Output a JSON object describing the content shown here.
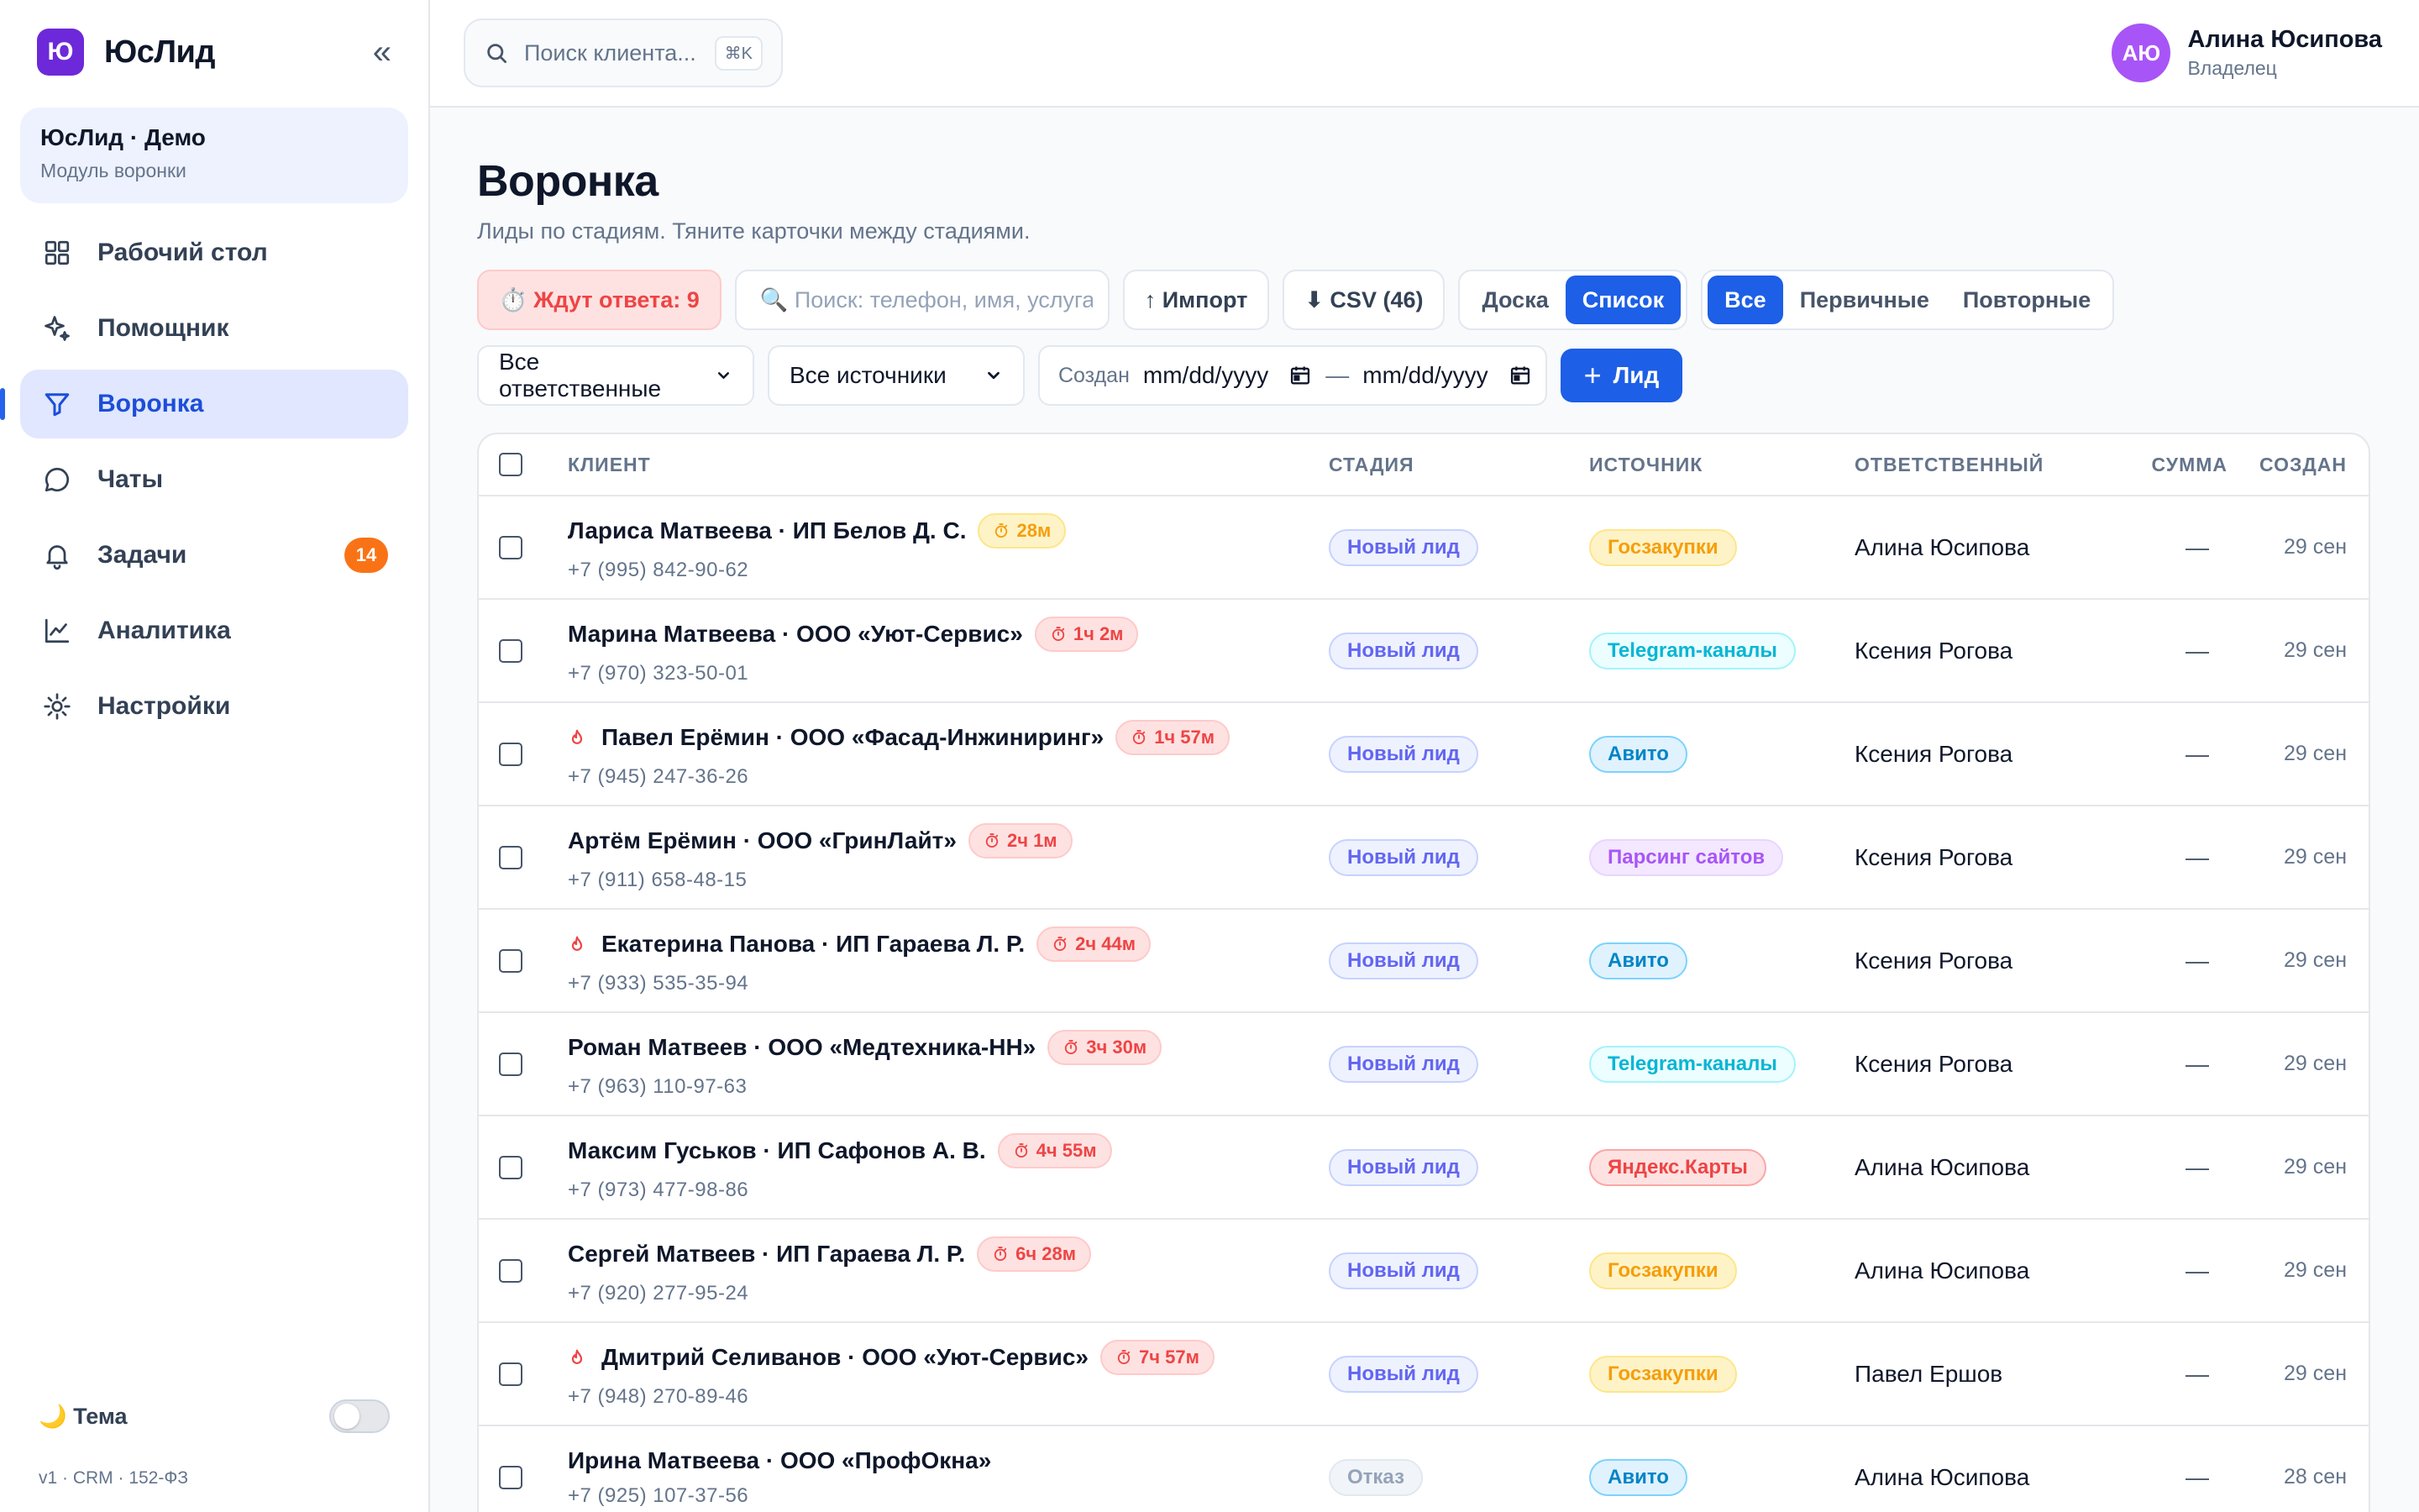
{
  "brand": {
    "logo_letter": "Ю",
    "name": "ЮсЛид",
    "collapse": "«"
  },
  "workspace": {
    "name": "ЮсЛид · Демо",
    "subtitle": "Модуль воронки"
  },
  "nav": [
    {
      "key": "dashboard",
      "label": "Рабочий стол",
      "icon": "grid-icon",
      "active": false
    },
    {
      "key": "assistant",
      "label": "Помощник",
      "icon": "sparkle-icon",
      "active": false
    },
    {
      "key": "funnel",
      "label": "Воронка",
      "icon": "funnel-icon",
      "active": true
    },
    {
      "key": "chats",
      "label": "Чаты",
      "icon": "chat-icon",
      "active": false
    },
    {
      "key": "tasks",
      "label": "Задачи",
      "icon": "bell-icon",
      "active": false,
      "badge": "14"
    },
    {
      "key": "analytics",
      "label": "Аналитика",
      "icon": "chart-line-icon",
      "active": false
    },
    {
      "key": "settings",
      "label": "Настройки",
      "icon": "sun-gear-icon",
      "active": false
    }
  ],
  "theme": {
    "label": "🌙 Тема",
    "dark": false
  },
  "version": "v1 · CRM · 152-ФЗ",
  "topbar": {
    "search_placeholder": "Поиск клиента...",
    "search_shortcut": "⌘K",
    "user": {
      "initials": "АЮ",
      "name": "Алина Юсипова",
      "role": "Владелец"
    }
  },
  "page": {
    "title": "Воронка",
    "subtitle": "Лиды по стадиям. Тяните карточки между стадиями."
  },
  "toolbar": {
    "awaiting": "⏱️ Ждут ответа: 9",
    "search_placeholder": "🔍 Поиск: телефон, имя, услуга",
    "import": "↑ Импорт",
    "csv": "⬇ CSV (46)",
    "view": {
      "board": "Доска",
      "list": "Список",
      "active": "list"
    },
    "type": {
      "all": "Все",
      "primary": "Первичные",
      "repeat": "Повторные",
      "active": "all"
    }
  },
  "filters": {
    "owner": "Все ответственные",
    "source": "Все источники",
    "created_label": "Создан",
    "date_from": "mm/dd/yyyy",
    "date_sep": "—",
    "date_to": "mm/dd/yyyy",
    "add_lead": "Лид",
    "add_plus": "+"
  },
  "table": {
    "columns": [
      "Клиент",
      "Стадия",
      "Источник",
      "Ответственный",
      "Сумма",
      "Создан"
    ],
    "rows": [
      {
        "hot": false,
        "client": "Лариса Матвеева · ИП Белов Д. С.",
        "timer": "28м",
        "timer_level": "amber",
        "phone": "+7 (995) 842-90-62",
        "stage": "Новый лид",
        "stage_kind": "new",
        "source": "Госзакупки",
        "source_kind": "gov",
        "owner": "Алина Юсипова",
        "sum": "—",
        "created": "29 сен"
      },
      {
        "hot": false,
        "client": "Марина Матвеева · ООО «Уют-Сервис»",
        "timer": "1ч 2м",
        "timer_level": "red",
        "phone": "+7 (970) 323-50-01",
        "stage": "Новый лид",
        "stage_kind": "new",
        "source": "Telegram-каналы",
        "source_kind": "tg",
        "owner": "Ксения Рогова",
        "sum": "—",
        "created": "29 сен"
      },
      {
        "hot": true,
        "client": "Павел Ерёмин · ООО «Фасад-Инжиниринг»",
        "timer": "1ч 57м",
        "timer_level": "red",
        "phone": "+7 (945) 247-36-26",
        "stage": "Новый лид",
        "stage_kind": "new",
        "source": "Авито",
        "source_kind": "avito",
        "owner": "Ксения Рогова",
        "sum": "—",
        "created": "29 сен"
      },
      {
        "hot": false,
        "client": "Артём Ерёмин · ООО «ГринЛайт»",
        "timer": "2ч 1м",
        "timer_level": "red",
        "phone": "+7 (911) 658-48-15",
        "stage": "Новый лид",
        "stage_kind": "new",
        "source": "Парсинг сайтов",
        "source_kind": "parse",
        "owner": "Ксения Рогова",
        "sum": "—",
        "created": "29 сен"
      },
      {
        "hot": true,
        "client": "Екатерина Панова · ИП Гараева Л. Р.",
        "timer": "2ч 44м",
        "timer_level": "red",
        "phone": "+7 (933) 535-35-94",
        "stage": "Новый лид",
        "stage_kind": "new",
        "source": "Авито",
        "source_kind": "avito",
        "owner": "Ксения Рогова",
        "sum": "—",
        "created": "29 сен"
      },
      {
        "hot": false,
        "client": "Роман Матвеев · ООО «Медтехника-НН»",
        "timer": "3ч 30м",
        "timer_level": "red",
        "phone": "+7 (963) 110-97-63",
        "stage": "Новый лид",
        "stage_kind": "new",
        "source": "Telegram-каналы",
        "source_kind": "tg",
        "owner": "Ксения Рогова",
        "sum": "—",
        "created": "29 сен"
      },
      {
        "hot": false,
        "client": "Максим Гуськов · ИП Сафонов А. В.",
        "timer": "4ч 55м",
        "timer_level": "red",
        "phone": "+7 (973) 477-98-86",
        "stage": "Новый лид",
        "stage_kind": "new",
        "source": "Яндекс.Карты",
        "source_kind": "yandex",
        "owner": "Алина Юсипова",
        "sum": "—",
        "created": "29 сен"
      },
      {
        "hot": false,
        "client": "Сергей Матвеев · ИП Гараева Л. Р.",
        "timer": "6ч 28м",
        "timer_level": "red",
        "phone": "+7 (920) 277-95-24",
        "stage": "Новый лид",
        "stage_kind": "new",
        "source": "Госзакупки",
        "source_kind": "gov",
        "owner": "Алина Юсипова",
        "sum": "—",
        "created": "29 сен"
      },
      {
        "hot": true,
        "client": "Дмитрий Селиванов · ООО «Уют-Сервис»",
        "timer": "7ч 57м",
        "timer_level": "red",
        "phone": "+7 (948) 270-89-46",
        "stage": "Новый лид",
        "stage_kind": "new",
        "source": "Госзакупки",
        "source_kind": "gov",
        "owner": "Павел Ершов",
        "sum": "—",
        "created": "29 сен"
      },
      {
        "hot": false,
        "client": "Ирина Матвеева · ООО «ПрофОкна»",
        "timer": "",
        "timer_level": "",
        "phone": "+7 (925) 107-37-56",
        "stage": "Отказ",
        "stage_kind": "lost",
        "source": "Авито",
        "source_kind": "avito",
        "owner": "Алина Юсипова",
        "sum": "—",
        "created": "28 сен"
      }
    ]
  },
  "colors": {
    "accent": "#1d5fe6",
    "brand": "#6d28d9",
    "stage_new": {
      "bg": "#eef2ff",
      "border": "#c7d2fe",
      "text": "#6366f1"
    },
    "stage_lost": {
      "bg": "#f1f5f9",
      "border": "#e2e8f0",
      "text": "#94a3b8"
    },
    "source_gov": {
      "bg": "#fef3c7",
      "border": "#fde68a",
      "text": "#f59e0b"
    },
    "source_tg": {
      "bg": "#ecfeff",
      "border": "#a5f3fc",
      "text": "#06b6d4"
    },
    "source_avito": {
      "bg": "#e0f2fe",
      "border": "#7dd3fc",
      "text": "#0284c7"
    },
    "source_parse": {
      "bg": "#f3e8ff",
      "border": "#e9d5ff",
      "text": "#a855f7"
    },
    "source_yandex": {
      "bg": "#fee2e2",
      "border": "#fca5a5",
      "text": "#ef4444"
    }
  }
}
